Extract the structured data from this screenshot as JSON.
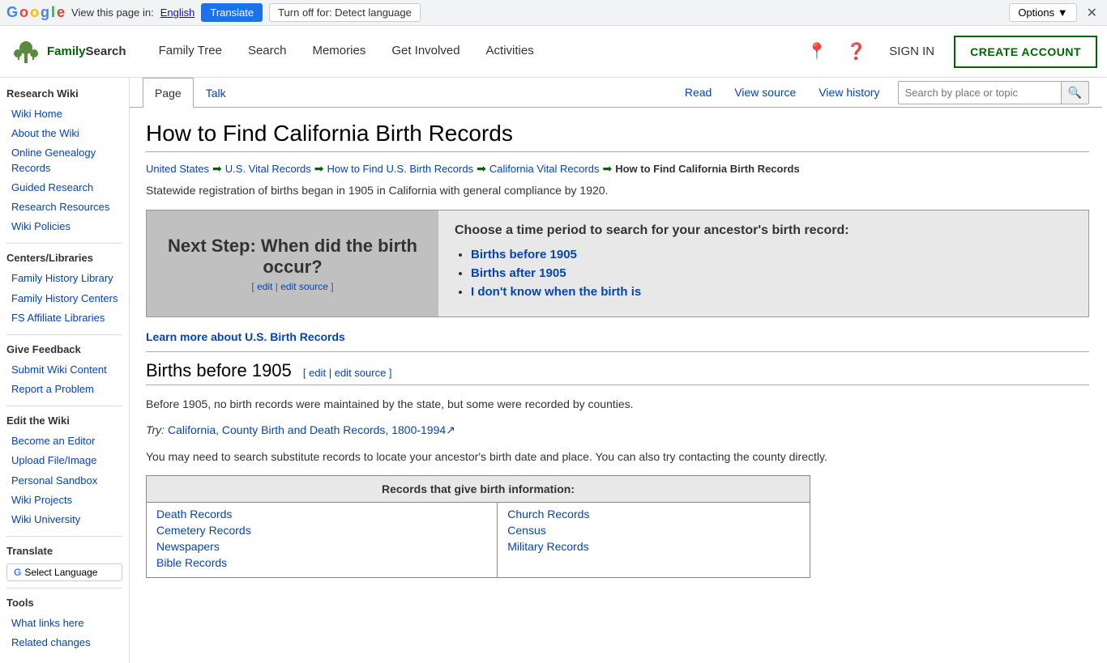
{
  "translate_bar": {
    "label": "View this page in:",
    "language": "English",
    "translate_btn": "Translate",
    "turnoff_btn": "Turn off for: Detect language",
    "options_btn": "Options ▼",
    "close": "✕"
  },
  "header": {
    "logo_text": "FamilySearch",
    "nav_items": [
      "Family Tree",
      "Search",
      "Memories",
      "Get Involved",
      "Activities"
    ],
    "sign_in": "SIGN IN",
    "create_account": "CREATE ACCOUNT"
  },
  "sidebar": {
    "sections": [
      {
        "title": "Research Wiki",
        "links": [
          "Wiki Home",
          "About the Wiki",
          "Online Genealogy Records",
          "Guided Research",
          "Research Resources",
          "Wiki Policies"
        ]
      },
      {
        "title": "Centers/Libraries",
        "links": [
          "Family History Library",
          "Family History Centers",
          "FS Affiliate Libraries"
        ]
      },
      {
        "title": "Give Feedback",
        "links": [
          "Submit Wiki Content",
          "Report a Problem"
        ]
      },
      {
        "title": "Edit the Wiki",
        "links": [
          "Become an Editor",
          "Upload File/Image",
          "Personal Sandbox",
          "Wiki Projects",
          "Wiki University"
        ]
      },
      {
        "title": "Translate",
        "links": []
      },
      {
        "title": "Tools",
        "links": [
          "What links here",
          "Related changes"
        ]
      }
    ],
    "translate_btn": "Select Language"
  },
  "tabs": {
    "page": "Page",
    "talk": "Talk",
    "read": "Read",
    "view_source": "View source",
    "view_history": "View history",
    "search_placeholder": "Search by place or topic"
  },
  "article": {
    "title": "How to Find California Birth Records",
    "breadcrumb": [
      {
        "text": "United States",
        "link": true
      },
      {
        "text": "U.S. Vital Records",
        "link": true
      },
      {
        "text": "How to Find U.S. Birth Records",
        "link": true
      },
      {
        "text": "California Vital Records",
        "link": true
      },
      {
        "text": "How to Find California Birth Records",
        "link": false
      }
    ],
    "intro": "Statewide registration of births began in 1905 in California with general compliance by 1920.",
    "info_box": {
      "left_title": "Next Step: When did the birth occur?",
      "left_links": [
        "edit",
        "edit source"
      ],
      "right_title": "Choose a time period to search for your ancestor's birth record:",
      "right_links": [
        "Births before 1905",
        "Births after 1905",
        "I don't know when the birth is"
      ]
    },
    "learn_more": "Learn more about U.S. Birth Records",
    "section1": {
      "title": "Births before 1905",
      "edit_link": "edit",
      "edit_source_link": "edit source",
      "para1": "Before 1905, no birth records were maintained by the state, but some were recorded by counties.",
      "try_text": "Try:",
      "try_link": "California, County Birth and Death Records, 1800-1994",
      "try_link_external": true,
      "para2": "You may need to search substitute records to locate your ancestor's birth date and place. You can also try contacting the county directly."
    },
    "records_table": {
      "header": "Records that give birth information:",
      "left_col": [
        "Death Records",
        "Cemetery Records",
        "Newspapers",
        "Bible Records"
      ],
      "right_col": [
        "Church Records",
        "Census",
        "Military Records"
      ]
    }
  }
}
